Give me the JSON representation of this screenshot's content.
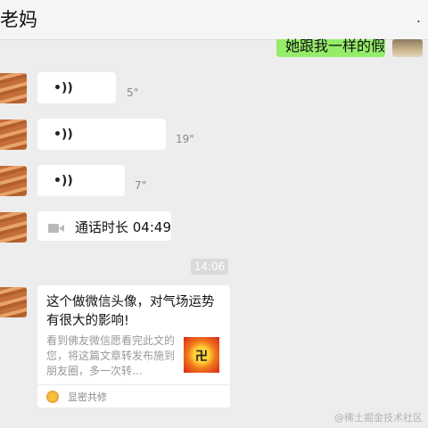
{
  "header": {
    "title": "老妈",
    "more": "."
  },
  "messages": [
    {
      "type": "text",
      "direction": "sent",
      "text": "她跟我一样的假"
    },
    {
      "type": "voice",
      "direction": "received",
      "icon": "voice-wave-icon",
      "duration": "5\""
    },
    {
      "type": "voice",
      "direction": "received",
      "icon": "voice-wave-icon",
      "duration": "19\""
    },
    {
      "type": "voice",
      "direction": "received",
      "icon": "voice-wave-icon",
      "duration": "7\""
    },
    {
      "type": "call",
      "direction": "received",
      "icon": "video-call-icon",
      "text": "通话时长 04:49"
    }
  ],
  "time_badge": "14:06",
  "share_card": {
    "title": "这个做微信头像，对气场运势有很大的影响!",
    "description": "看到佛友微信愿看完此文的您，将这篇文章转发布施到朋友圈，多一次转…",
    "thumb_symbol": "卍",
    "source": "显密共修"
  },
  "watermark": "@稀土掘金技术社区",
  "voice_glyph": "◂))"
}
